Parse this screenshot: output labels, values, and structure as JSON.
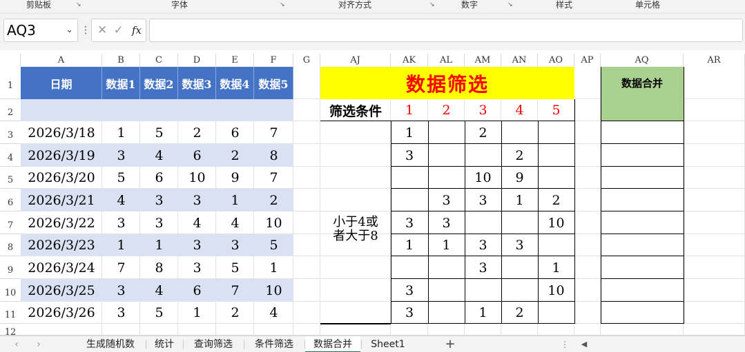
{
  "ribbon": {
    "groups": [
      "剪贴板",
      "字体",
      "对齐方式",
      "数字",
      "样式",
      "单元格"
    ]
  },
  "formula_bar": {
    "name_box": "AQ3",
    "fx_label": "fx",
    "formula": ""
  },
  "columns": [
    "A",
    "B",
    "C",
    "D",
    "E",
    "F",
    "G",
    "AJ",
    "AK",
    "AL",
    "AM",
    "AN",
    "AO",
    "AP",
    "AQ",
    "AR"
  ],
  "rows": [
    "1",
    "2",
    "3",
    "4",
    "5",
    "6",
    "7",
    "8",
    "9",
    "10",
    "11",
    "12"
  ],
  "left_table": {
    "headers": [
      "日期",
      "数据1",
      "数据2",
      "数据3",
      "数据4",
      "数据5"
    ],
    "rows": [
      [
        "2026/3/18",
        "1",
        "5",
        "2",
        "6",
        "7"
      ],
      [
        "2026/3/19",
        "3",
        "4",
        "6",
        "2",
        "8"
      ],
      [
        "2026/3/20",
        "5",
        "6",
        "10",
        "9",
        "7"
      ],
      [
        "2026/3/21",
        "4",
        "3",
        "3",
        "1",
        "2"
      ],
      [
        "2026/3/22",
        "3",
        "3",
        "4",
        "4",
        "10"
      ],
      [
        "2026/3/23",
        "1",
        "1",
        "3",
        "3",
        "5"
      ],
      [
        "2026/3/24",
        "7",
        "8",
        "3",
        "5",
        "1"
      ],
      [
        "2026/3/25",
        "3",
        "4",
        "6",
        "7",
        "10"
      ],
      [
        "2026/3/26",
        "3",
        "5",
        "1",
        "2",
        "4"
      ]
    ]
  },
  "filter_table": {
    "title": "数据筛选",
    "condition_label": "筛选条件",
    "condition_numbers": [
      "1",
      "2",
      "3",
      "4",
      "5"
    ],
    "condition_text_line1": "小于4或",
    "condition_text_line2": "者大于8",
    "rows": [
      [
        "1",
        "",
        "2",
        "",
        ""
      ],
      [
        "3",
        "",
        "",
        "2",
        ""
      ],
      [
        "",
        "",
        "10",
        "9",
        ""
      ],
      [
        "",
        "3",
        "3",
        "1",
        "2"
      ],
      [
        "3",
        "3",
        "",
        "",
        "10"
      ],
      [
        "1",
        "1",
        "3",
        "3",
        ""
      ],
      [
        "",
        "",
        "3",
        "",
        "1"
      ],
      [
        "3",
        "",
        "",
        "",
        "10"
      ],
      [
        "3",
        "",
        "1",
        "2",
        ""
      ]
    ]
  },
  "merge_table": {
    "header": "数据合并"
  },
  "sheet_tabs": [
    "生成随机数",
    "统计",
    "查询筛选",
    "条件筛选",
    "数据合并",
    "Sheet1"
  ],
  "active_tab": "数据合并",
  "add_sheet": "+",
  "colors": {
    "header_blue": "#4472c4",
    "band_blue": "#d9e1f2",
    "title_yellow": "#ffff00",
    "title_red": "#ff0000",
    "merge_green": "#a9d08e"
  }
}
